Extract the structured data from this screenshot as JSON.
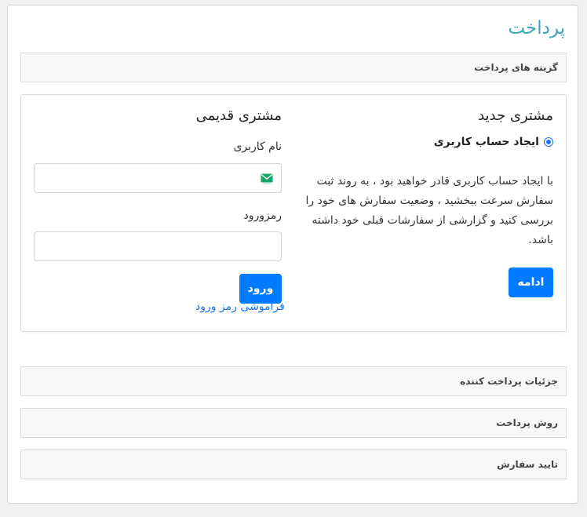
{
  "page_title": "پرداخت",
  "sections": {
    "payment_options": "گزینه های پرداخت",
    "payer_details": "جزئیات پرداخت کننده",
    "payment_method": "روش پرداخت",
    "order_confirm": "تایید سفارش"
  },
  "new_customer": {
    "heading": "مشتری جدید",
    "radio_label": "ایجاد حساب کاربری",
    "radio_checked": true,
    "description": "با ایجاد حساب کاربری قادر خواهید بود ، به روند ثبت سفارش سرعت ببخشید ، وضعیت سفارش های خود را بررسی کنید و گزارشی از سفارشات قبلی خود داشته باشد.",
    "continue_button": "ادامه"
  },
  "returning_customer": {
    "heading": "مشتری قدیمی",
    "username_label": "نام کاربری",
    "username_value": "",
    "password_label": "رمزورود",
    "password_value": "",
    "login_button": "ورود",
    "forgot_link": "فراموشی رمز ورود"
  },
  "colors": {
    "title": "#3aa6b9",
    "primary": "#007bff",
    "link": "#1a73e8"
  },
  "icons": {
    "username_field_icon": "mail-icon"
  }
}
